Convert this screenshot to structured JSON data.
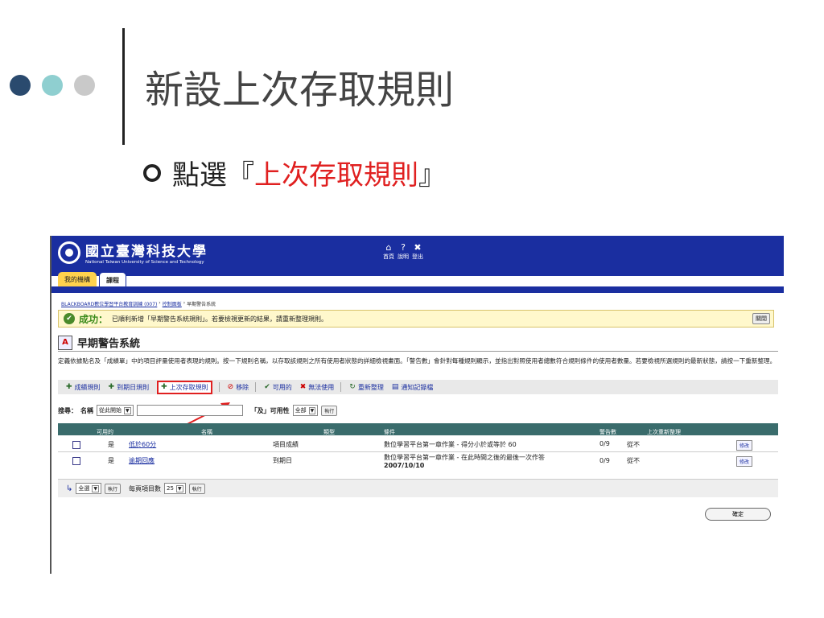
{
  "slide": {
    "title": "新設上次存取規則",
    "bullet_prefix": "點選『",
    "bullet_highlight": "上次存取規則",
    "bullet_suffix": "』"
  },
  "app": {
    "logo_cn": "國立臺灣科技大學",
    "logo_en": "National Taiwan University of Science and Technology",
    "nav": [
      {
        "icon": "home-icon",
        "label": "首頁"
      },
      {
        "icon": "help-icon",
        "label": "說明"
      },
      {
        "icon": "logout-icon",
        "label": "登出"
      }
    ],
    "tabs": [
      "我的機構",
      "課程"
    ],
    "breadcrumb": [
      "BLACKBOARD數位學習平台教育訓練 (007)",
      "控制面板",
      "早期警告系統"
    ],
    "success": {
      "label": "成功：",
      "message": "已順利新增「早期警告系統規則」。若要檢視更新的結果，請重新整理規則。",
      "close": "關閉"
    },
    "section_title": "早期警告系統",
    "description": "定義依據點名及「成績單」中的項目評量使用者表現的規則。按一下規則名稱，以存取該規則之所有使用者狀態的詳細檢視畫面。「警告數」會針對每種規則顯示，並指出對照使用者總數符合規則條件的使用者數量。若要檢視所選規則的最新狀態，請按一下重新整理。",
    "toolbar": [
      {
        "icon": "grade-rule-icon",
        "label": "成績規則"
      },
      {
        "icon": "due-date-rule-icon",
        "label": "到期日規則"
      },
      {
        "icon": "last-access-rule-icon",
        "label": "上次存取規則"
      },
      {
        "icon": "remove-icon",
        "label": "移除"
      },
      {
        "icon": "checkmark-icon",
        "label": "可用的"
      },
      {
        "icon": "x-icon",
        "label": "無法使用"
      },
      {
        "icon": "refresh-icon",
        "label": "重新整理"
      },
      {
        "icon": "notification-log-icon",
        "label": "通知記錄檔"
      }
    ],
    "search": {
      "label": "搜尋：",
      "name_label": "名稱",
      "name_op": "從此開始",
      "and_label": "「及」可用性",
      "availability": "全部",
      "go": "執行"
    },
    "columns": [
      "可用的",
      "名稱",
      "類型",
      "條件",
      "警告數",
      "上次重新整理"
    ],
    "rows": [
      {
        "available": "是",
        "name": "低於60分",
        "type": "項目成績",
        "condition": "數位學習平台第一章作業 - 得分小於或等於 60",
        "warnings": "0/9",
        "last_refresh": "從不",
        "edit": "修改"
      },
      {
        "available": "是",
        "name": "逾期回應",
        "type": "到期日",
        "condition": "數位學習平台第一章作業 - 在此時間之後的最後一次作答",
        "condition_date": "2007/10/10",
        "warnings": "0/9",
        "last_refresh": "從不",
        "edit": "修改"
      }
    ],
    "bottom": {
      "select_all": "全選",
      "go": "執行",
      "per_page_label": "每頁項目數",
      "per_page": "25",
      "go2": "執行"
    },
    "ok": "確定"
  }
}
